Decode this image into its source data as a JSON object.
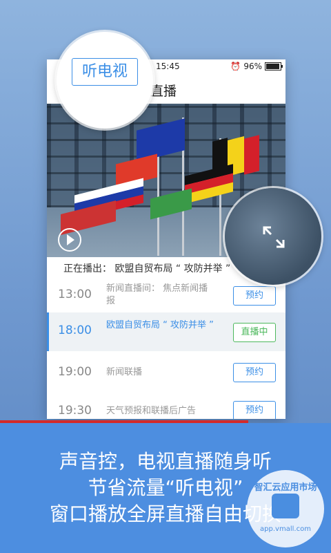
{
  "status_bar": {
    "time": "15:45",
    "battery": "96%"
  },
  "header": {
    "title": "直播",
    "tv_button": "听电视"
  },
  "now_playing": {
    "text": "正在播出： 欧盟自贸布局 “ 攻防并举 ”"
  },
  "schedule": [
    {
      "time": "13:00",
      "program": "新闻直播间： 焦点新闻播报",
      "button": "预约",
      "active": false
    },
    {
      "time": "18:00",
      "program": "欧盟自贸布局 “ 攻防并举 ”",
      "button": "直播中",
      "active": true
    },
    {
      "time": "19:00",
      "program": "新闻联播",
      "button": "预约",
      "active": false
    },
    {
      "time": "19:30",
      "program": "天气预报和联播后广告",
      "button": "预约",
      "active": false
    }
  ],
  "captions": [
    "声音控，电视直播随身听",
    "节省流量“听电视”",
    "窗口播放全屏直播自由切换"
  ],
  "watermark": {
    "name": "智汇云应用市场",
    "url": "app.vmall.com"
  },
  "colors": {
    "accent": "#3a8ee6",
    "live": "#4cb85c",
    "banner": "#4d8ee0",
    "redline": "#d32a2a"
  }
}
